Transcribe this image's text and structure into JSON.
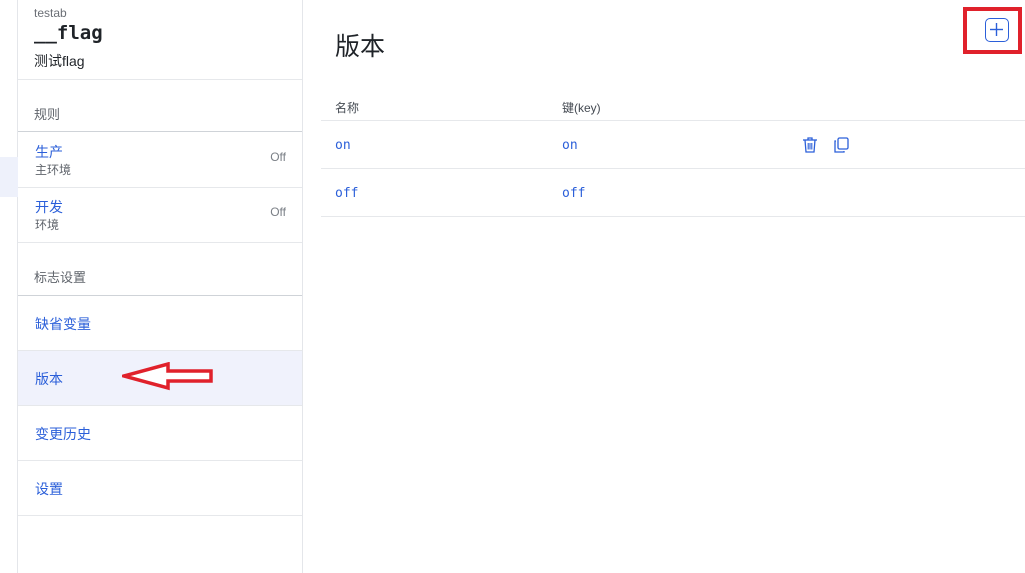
{
  "flag": {
    "project": "testab",
    "key": "__flag",
    "name": "测试flag"
  },
  "sidebar": {
    "rules_title": "规则",
    "environments": [
      {
        "name": "生产",
        "desc": "主环境",
        "status": "Off"
      },
      {
        "name": "开发",
        "desc": "环境",
        "status": "Off"
      }
    ],
    "settings_title": "标志设置",
    "nav": [
      {
        "label": "缺省变量",
        "active": false
      },
      {
        "label": "版本",
        "active": true
      },
      {
        "label": "变更历史",
        "active": false
      },
      {
        "label": "设置",
        "active": false
      }
    ]
  },
  "main": {
    "title": "版本",
    "columns": {
      "name": "名称",
      "key": "键(key)"
    },
    "rows": [
      {
        "name": "on",
        "key": "on"
      },
      {
        "name": "off",
        "key": "off"
      }
    ]
  },
  "colors": {
    "accent": "#2b5fd9",
    "annotation_red": "#e0212b",
    "active_bg": "#f0f2fc"
  },
  "icons": {
    "add": "plus-icon",
    "delete": "trash-icon",
    "copy": "copy-icon",
    "annotation": "left-arrow-annotation"
  }
}
